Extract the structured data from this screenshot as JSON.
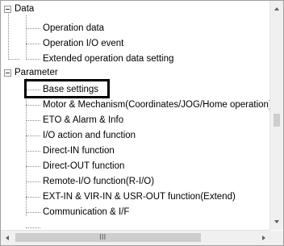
{
  "tree": {
    "items": [
      {
        "label": "Data"
      },
      {
        "label": "Operation data"
      },
      {
        "label": "Operation I/O event"
      },
      {
        "label": "Extended operation data setting"
      },
      {
        "label": "Parameter"
      },
      {
        "label": "Base settings"
      },
      {
        "label": "Motor & Mechanism(Coordinates/JOG/Home operation)"
      },
      {
        "label": "ETO & Alarm & Info"
      },
      {
        "label": "I/O action and function"
      },
      {
        "label": "Direct-IN function"
      },
      {
        "label": "Direct-OUT function"
      },
      {
        "label": "Remote-I/O function(R-I/O)"
      },
      {
        "label": "EXT-IN & VIR-IN & USR-OUT function(Extend)"
      },
      {
        "label": "Communication & I/F"
      }
    ]
  },
  "scrollbar": {
    "horizontal_thumb_grip": "III"
  }
}
